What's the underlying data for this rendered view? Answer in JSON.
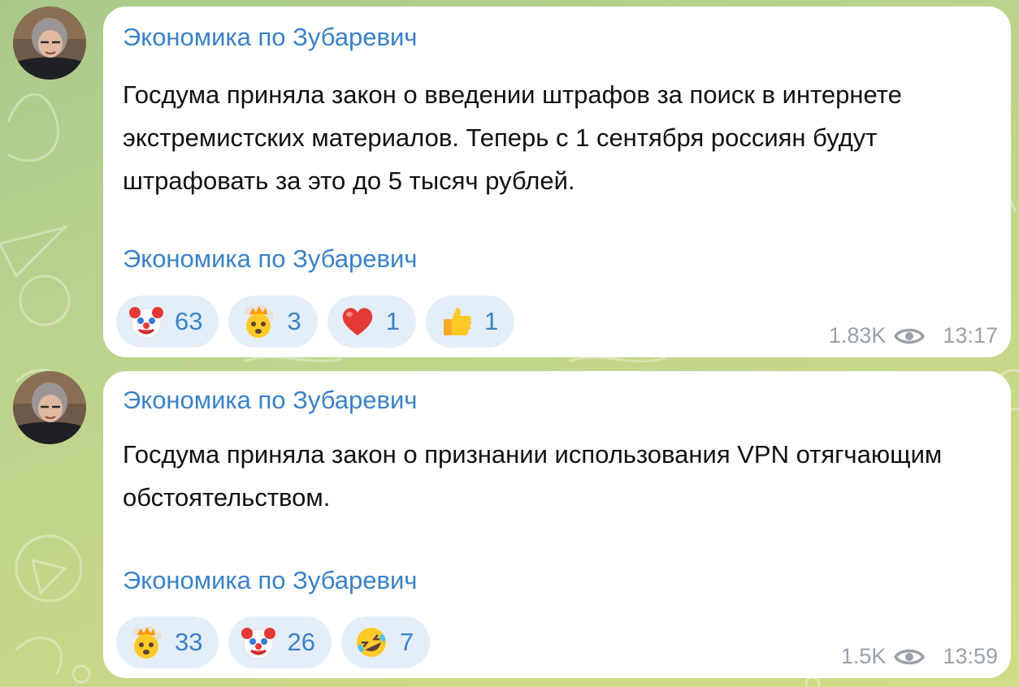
{
  "colors": {
    "accent": "#3a82c6",
    "reaction_bg": "#e4eef8",
    "meta_text": "#9aa1a8",
    "bubble_bg": "#ffffff",
    "wallpaper": "#b9d28d"
  },
  "posts": [
    {
      "channel_name": "Экономика по Зубаревич",
      "text": "Госдума приняла закон о введении штрафов за поиск в интернете экстремистских материалов. Теперь с 1 сентября россиян будут штрафовать за это до 5 тысяч рублей.",
      "footer_link": "Экономика по Зубаревич",
      "reactions": [
        {
          "icon": "clown-face-icon",
          "count": "63"
        },
        {
          "icon": "exploding-head-icon",
          "count": "3"
        },
        {
          "icon": "red-heart-icon",
          "count": "1"
        },
        {
          "icon": "thumbs-up-icon",
          "count": "1"
        }
      ],
      "views": "1.83K",
      "time": "13:17"
    },
    {
      "channel_name": "Экономика по Зубаревич",
      "text": "Госдума приняла закон о признании использования VPN отягчающим обстоятельством.",
      "footer_link": "Экономика по Зубаревич",
      "reactions": [
        {
          "icon": "exploding-head-icon",
          "count": "33"
        },
        {
          "icon": "clown-face-icon",
          "count": "26"
        },
        {
          "icon": "rolling-laughing-icon",
          "count": "7"
        }
      ],
      "views": "1.5K",
      "time": "13:59"
    }
  ]
}
